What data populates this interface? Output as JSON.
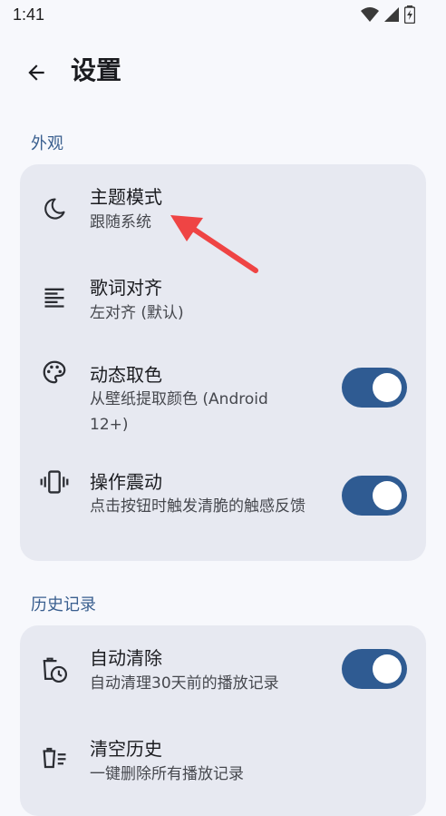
{
  "status": {
    "time": "1:41"
  },
  "header": {
    "title": "设置"
  },
  "sections": [
    {
      "label": "外观",
      "items": [
        {
          "title": "主题模式",
          "subtitle": "跟随系统",
          "icon": "moon-icon"
        },
        {
          "title": "歌词对齐",
          "subtitle": "左对齐 (默认)",
          "icon": "align-left-icon"
        },
        {
          "title": "动态取色",
          "subtitle": "从壁纸提取颜色 (Android 12+)",
          "icon": "palette-icon",
          "toggle": true
        },
        {
          "title": "操作震动",
          "subtitle": "点击按钮时触发清脆的触感反馈",
          "icon": "vibration-icon",
          "toggle": true
        }
      ]
    },
    {
      "label": "历史记录",
      "items": [
        {
          "title": "自动清除",
          "subtitle": "自动清理30天前的播放记录",
          "icon": "history-clear-icon",
          "toggle": true
        },
        {
          "title": "清空历史",
          "subtitle": "一键删除所有播放记录",
          "icon": "delete-list-icon"
        }
      ]
    }
  ],
  "colors": {
    "accent": "#2f5b92",
    "card": "#e7e9f1",
    "background": "#f7f8fc",
    "section_label": "#3a5f8f",
    "annotation_arrow": "#ef4444"
  }
}
